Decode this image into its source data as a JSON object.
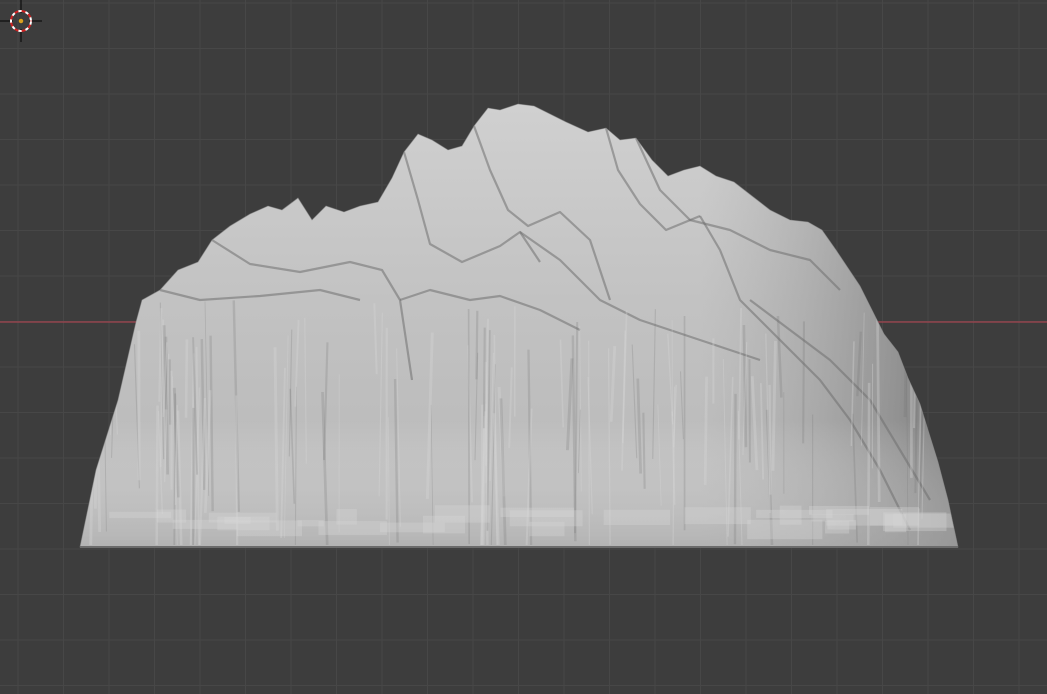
{
  "viewport": {
    "background_color": "#3d3d3d",
    "grid_minor_color": "#474747",
    "grid_major_color": "#4a4a4a",
    "x_axis_color": "#a24450",
    "mesh_color": "#bdbdbd",
    "mesh_shadow_color": "#6f6f6f",
    "mesh_highlight_color": "#d6d6d6"
  },
  "scene": {
    "object": "terrain-mesh",
    "cursor": "3d-cursor-icon",
    "axis": "x-axis-line"
  }
}
